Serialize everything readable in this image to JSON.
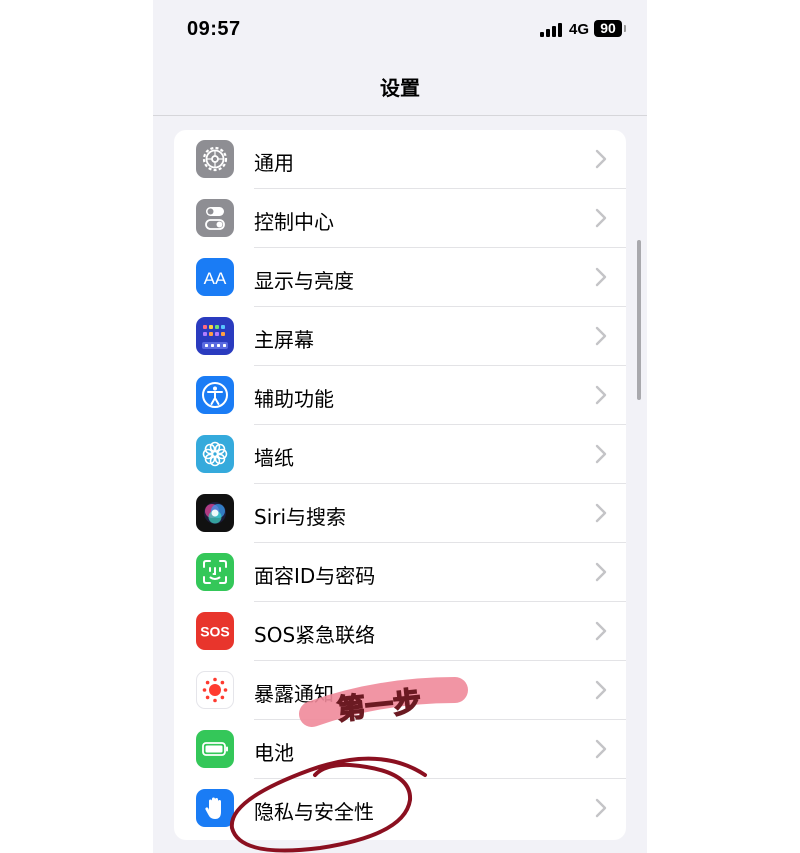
{
  "status_bar": {
    "time": "09:57",
    "network": "4G",
    "battery": "90"
  },
  "nav": {
    "title": "设置"
  },
  "settings": [
    {
      "label": "通用",
      "icon": "gear-icon",
      "color": "#8e8e93"
    },
    {
      "label": "控制中心",
      "icon": "toggles-icon",
      "color": "#8e8e93"
    },
    {
      "label": "显示与亮度",
      "icon": "aa-icon",
      "color": "#1a7cf5"
    },
    {
      "label": "主屏幕",
      "icon": "home-screen-icon",
      "color": "#2a3bbf"
    },
    {
      "label": "辅助功能",
      "icon": "accessibility-icon",
      "color": "#1a7cf5"
    },
    {
      "label": "墙纸",
      "icon": "flower-icon",
      "color": "#35aadc"
    },
    {
      "label": "Siri与搜索",
      "icon": "siri-icon",
      "color": "#111111"
    },
    {
      "label": "面容ID与密码",
      "icon": "face-id-icon",
      "color": "#34c759"
    },
    {
      "label": "SOS紧急联络",
      "icon": "sos-icon",
      "color": "#e8352c"
    },
    {
      "label": "暴露通知",
      "icon": "exposure-icon",
      "color": "#ffffff"
    },
    {
      "label": "电池",
      "icon": "battery-icon",
      "color": "#34c759"
    },
    {
      "label": "隐私与安全性",
      "icon": "hand-icon",
      "color": "#1a7cf5"
    }
  ],
  "icon_text": {
    "aa": "AA",
    "sos": "SOS"
  },
  "annotation": {
    "text": "第一步",
    "highlight_color": "#f08a9a",
    "circle_color": "#8b1020"
  }
}
